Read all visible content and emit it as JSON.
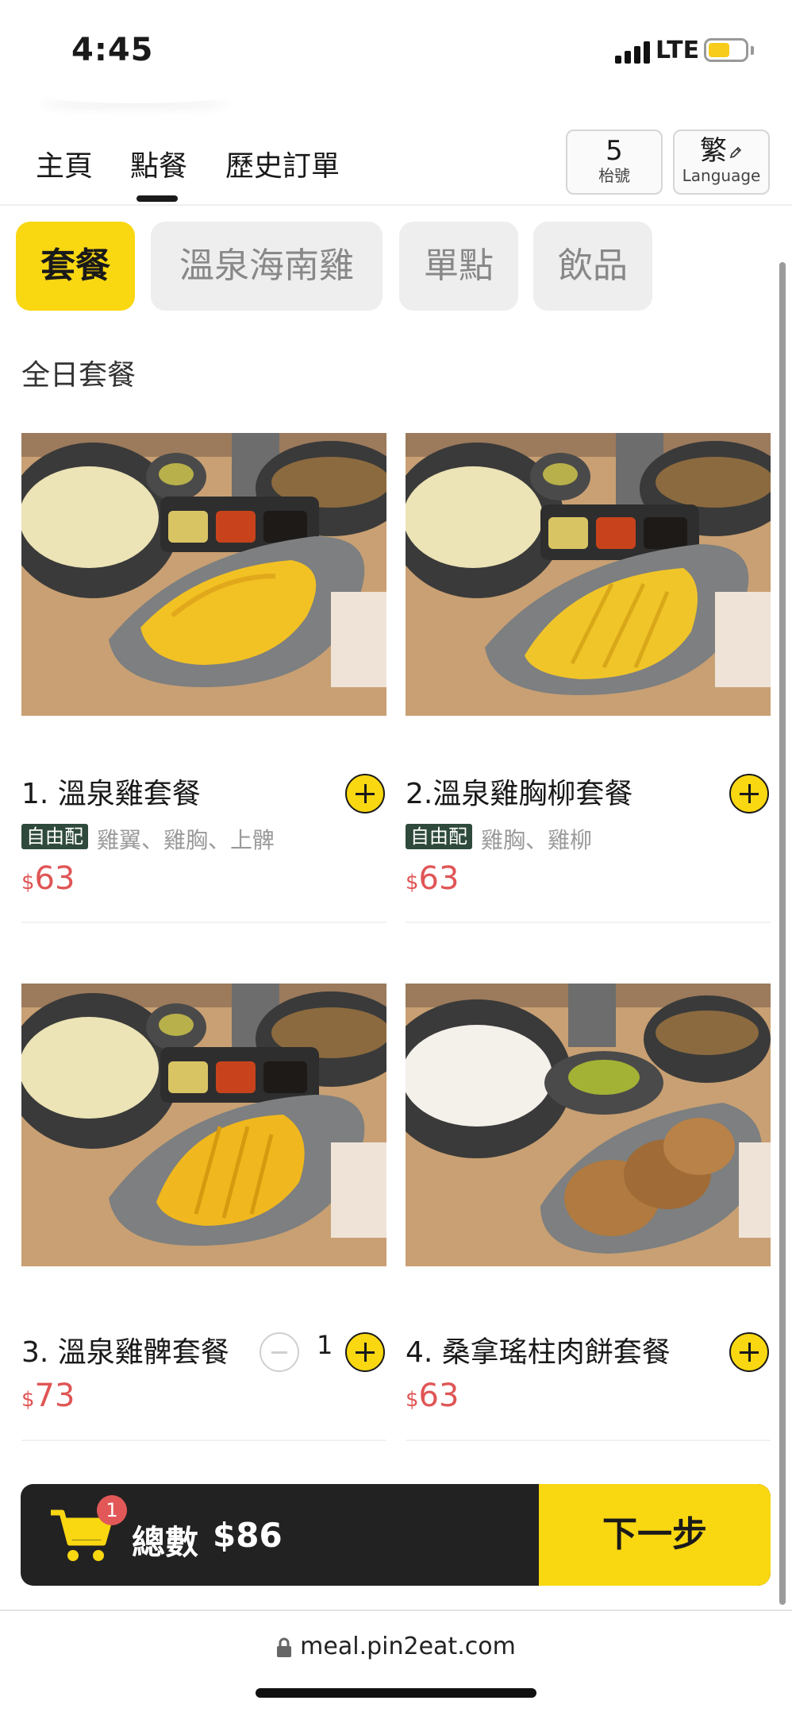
{
  "status_bar": {
    "time": "4:45",
    "network": "LTE",
    "battery_level": 0.6
  },
  "nav": {
    "tabs": [
      {
        "label": "主頁"
      },
      {
        "label": "點餐"
      },
      {
        "label": "歷史訂單"
      }
    ],
    "active_tab": "點餐",
    "table": {
      "number": "5",
      "label": "枱號"
    },
    "language": {
      "symbol": "繁",
      "label": "Language"
    }
  },
  "categories": [
    {
      "label": "套餐"
    },
    {
      "label": "溫泉海南雞"
    },
    {
      "label": "單點"
    },
    {
      "label": "飲品"
    }
  ],
  "active_category": "套餐",
  "section_title": "全日套餐",
  "products": [
    {
      "name": "1. 溫泉雞套餐",
      "tag": "自由配",
      "options": "雞翼、雞胸、上髀",
      "currency": "$",
      "price": "63"
    },
    {
      "name": "2.溫泉雞胸柳套餐",
      "tag": "自由配",
      "options": "雞胸、雞柳",
      "currency": "$",
      "price": "63"
    },
    {
      "name": "3. 溫泉雞髀套餐",
      "currency": "$",
      "price": "73",
      "quantity": "1"
    },
    {
      "name": "4. 桑拿瑤柱肉餅套餐",
      "currency": "$",
      "price": "63"
    }
  ],
  "cart": {
    "count": "1",
    "total_label": "總數",
    "total": "$86",
    "next_label": "下一步"
  },
  "browser": {
    "url": "meal.pin2eat.com"
  },
  "colors": {
    "accent": "#f9d711",
    "price": "#e05555",
    "dark": "#222222",
    "tag": "#2f4a3c"
  }
}
